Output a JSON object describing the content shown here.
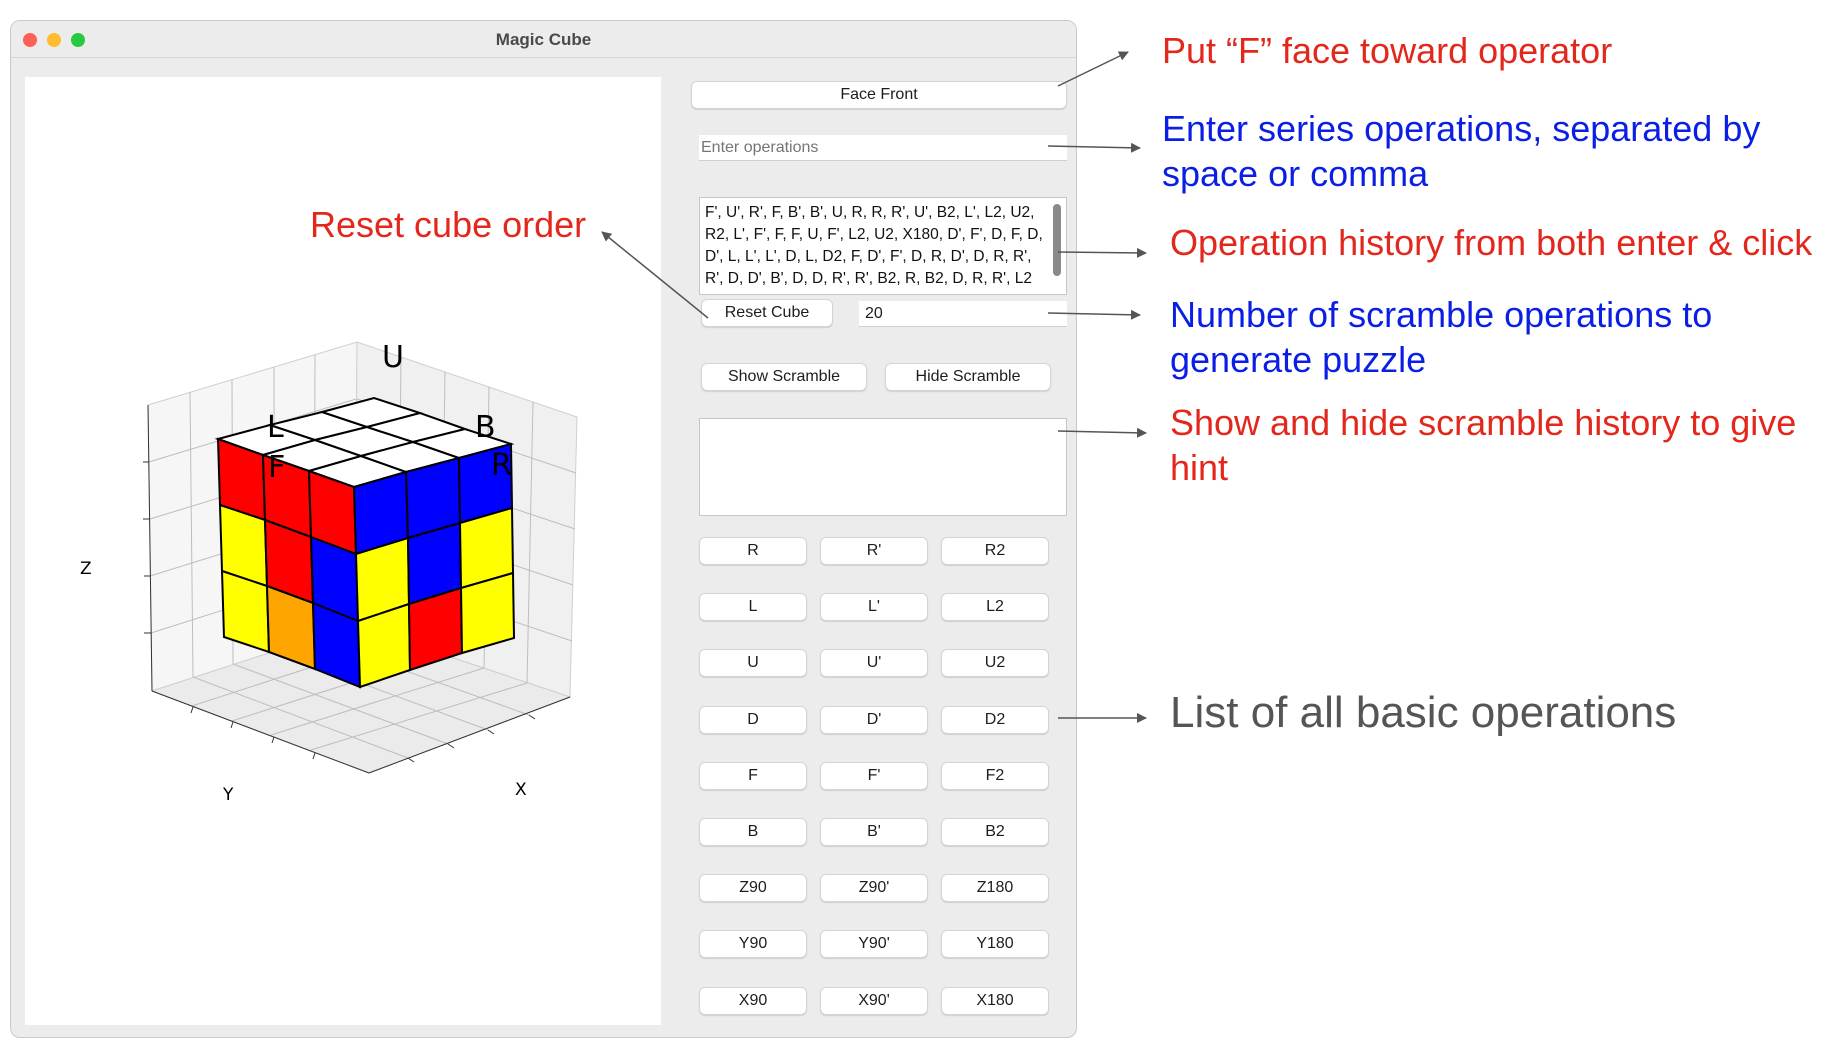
{
  "window": {
    "title": "Magic Cube"
  },
  "plot": {
    "face_labels": {
      "U": "U",
      "L": "L",
      "B": "B",
      "F": "F",
      "R": "R"
    },
    "axis_labels": {
      "x": "X",
      "y": "Y",
      "z": "Z"
    },
    "colors": {
      "red": "#ff0000",
      "blue": "#0000ff",
      "yellow": "#ffff00",
      "orange": "#ffa500",
      "white": "#ffffff"
    }
  },
  "controls": {
    "face_front": "Face Front",
    "operations_placeholder": "Enter operations",
    "history_text": "F', U', R', F, B', B', U, R, R, R', U', B2, L', L2, U2, R2, L', F', F, F, U, F', L2, U2, X180, D', F', D, F, D, D', L, L', L', D, L, D2, F, D', F', D, R, D', D, R, R', R', D, D', B', D, D, R', R', B2, R, B2, D, R, R', L2",
    "reset_cube": "Reset Cube",
    "scramble_count": "20",
    "show_scramble": "Show Scramble",
    "hide_scramble": "Hide Scramble",
    "scramble_history": "",
    "operations": [
      [
        "R",
        "R'",
        "R2"
      ],
      [
        "L",
        "L'",
        "L2"
      ],
      [
        "U",
        "U'",
        "U2"
      ],
      [
        "D",
        "D'",
        "D2"
      ],
      [
        "F",
        "F'",
        "F2"
      ],
      [
        "B",
        "B'",
        "B2"
      ],
      [
        "Z90",
        "Z90'",
        "Z180"
      ],
      [
        "Y90",
        "Y90'",
        "Y180"
      ],
      [
        "X90",
        "X90'",
        "X180"
      ]
    ]
  },
  "annotations": {
    "face_front": "Put “F” face toward operator",
    "enter_ops_1": "Enter series operations, separated by",
    "enter_ops_2": "space or comma",
    "reset": "Reset cube order",
    "history": "Operation history from both enter & click",
    "scramble_1": "Number of scramble operations to",
    "scramble_2": "generate puzzle",
    "showhide_1": "Show and hide scramble history to give",
    "showhide_2": "hint",
    "basic_ops": "List of all basic operations"
  }
}
